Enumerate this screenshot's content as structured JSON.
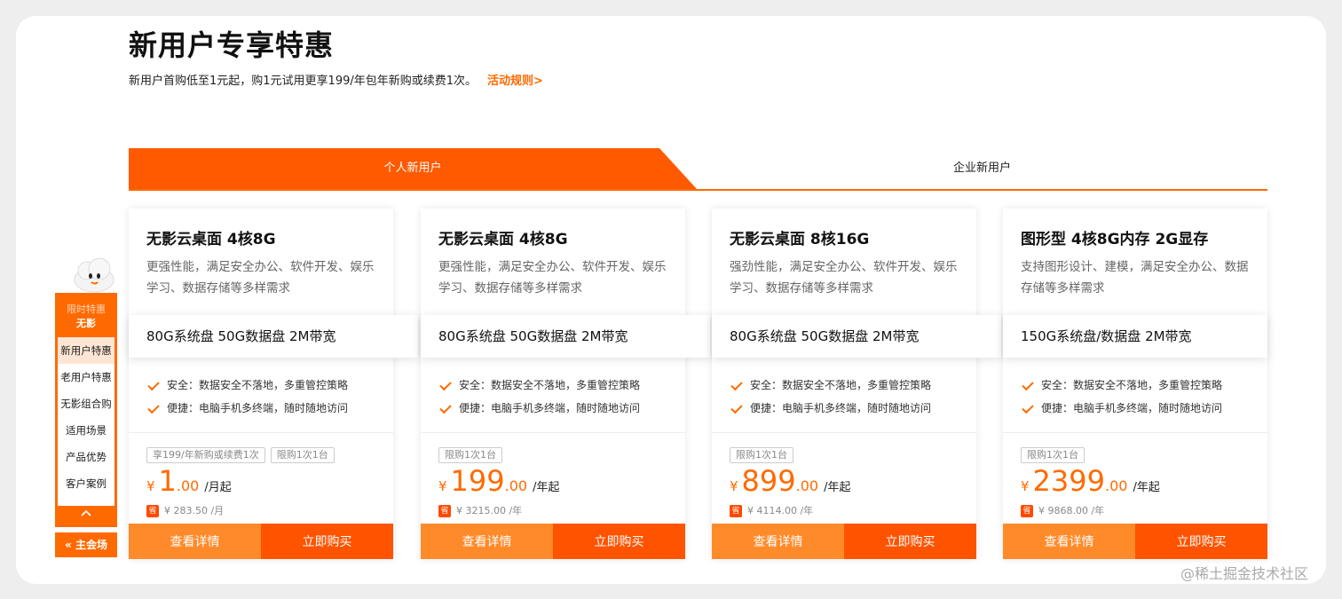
{
  "header": {
    "title": "新用户专享特惠",
    "subtitle": "新用户首购低至1元起，购1元试用更享199/年包年新购或续费1次。",
    "rules_link": "活动规则>"
  },
  "tabs": [
    {
      "label": "个人新用户",
      "active": true
    },
    {
      "label": "企业新用户",
      "active": false
    }
  ],
  "side_nav": {
    "badge_line1": "限时特惠",
    "badge_line2": "无影",
    "items": [
      {
        "label": "新用户特惠",
        "active": true
      },
      {
        "label": "老用户特惠"
      },
      {
        "label": "无影组合购"
      },
      {
        "label": "适用场景"
      },
      {
        "label": "产品优势"
      },
      {
        "label": "客户案例"
      }
    ],
    "up_icon": "chevron-up-icon",
    "main_venue": "主会场",
    "main_venue_icon": "double-chevron-left-icon"
  },
  "cards": [
    {
      "name": "无影云桌面 4核8G",
      "desc": "更强性能，满足安全办公、软件开发、娱乐学习、数据存储等多样需求",
      "spec": "80G系统盘 50G数据盘 2M带宽",
      "features": [
        "安全：数据安全不落地，多重管控策略",
        "便捷：电脑手机多终端，随时随地访问"
      ],
      "tags": [
        "享199/年新购或续费1次",
        "限购1次1台"
      ],
      "currency": "¥",
      "price_int": "1",
      "price_dec": ".00",
      "unit": "/月起",
      "save_badge": "省",
      "original": "¥ 283.50 /月",
      "detail_btn": "查看详情",
      "buy_btn": "立即购买"
    },
    {
      "name": "无影云桌面 4核8G",
      "desc": "更强性能，满足安全办公、软件开发、娱乐学习、数据存储等多样需求",
      "spec": "80G系统盘 50G数据盘 2M带宽",
      "features": [
        "安全：数据安全不落地，多重管控策略",
        "便捷：电脑手机多终端，随时随地访问"
      ],
      "tags": [
        "限购1次1台"
      ],
      "currency": "¥",
      "price_int": "199",
      "price_dec": ".00",
      "unit": "/年起",
      "save_badge": "省",
      "original": "¥ 3215.00 /年",
      "detail_btn": "查看详情",
      "buy_btn": "立即购买"
    },
    {
      "name": "无影云桌面 8核16G",
      "desc": "强劲性能，满足安全办公、软件开发、娱乐学习、数据存储等多样需求",
      "spec": "80G系统盘 50G数据盘 2M带宽",
      "features": [
        "安全：数据安全不落地，多重管控策略",
        "便捷：电脑手机多终端，随时随地访问"
      ],
      "tags": [
        "限购1次1台"
      ],
      "currency": "¥",
      "price_int": "899",
      "price_dec": ".00",
      "unit": "/年起",
      "save_badge": "省",
      "original": "¥ 4114.00 /年",
      "detail_btn": "查看详情",
      "buy_btn": "立即购买"
    },
    {
      "name": "图形型 4核8G内存 2G显存",
      "desc": "支持图形设计、建模，满足安全办公、数据存储等多样需求",
      "spec": "150G系统盘/数据盘 2M带宽",
      "features": [
        "安全：数据安全不落地，多重管控策略",
        "便捷：电脑手机多终端，随时随地访问"
      ],
      "tags": [
        "限购1次1台"
      ],
      "currency": "¥",
      "price_int": "2399",
      "price_dec": ".00",
      "unit": "/年起",
      "save_badge": "省",
      "original": "¥ 9868.00 /年",
      "detail_btn": "查看详情",
      "buy_btn": "立即购买"
    }
  ],
  "watermark": "@稀土掘金技术社区",
  "colors": {
    "accent": "#ff6a00",
    "buy": "#ff5300",
    "detail": "#ff8a2a"
  }
}
